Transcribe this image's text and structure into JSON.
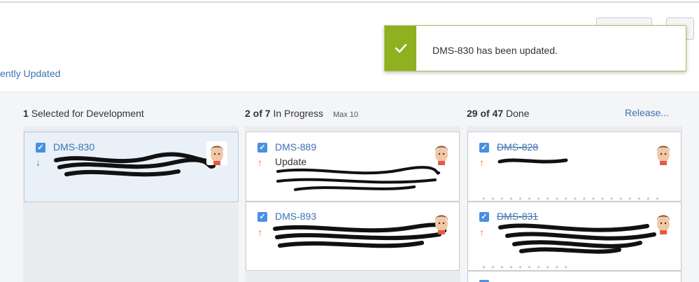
{
  "filter": {
    "recent_label": "ently Updated"
  },
  "toast": {
    "message": "DMS-830 has been updated."
  },
  "columns": [
    {
      "count": "1",
      "title": "Selected for Development",
      "max": ""
    },
    {
      "count": "2 of 7",
      "title": "In Progress",
      "max": "Max 10"
    },
    {
      "count": "29 of 47",
      "title": "Done",
      "max": ""
    }
  ],
  "release_link": "Release...",
  "cards": [
    {
      "key": "DMS-830",
      "summary": "",
      "priority": "down",
      "done": false
    },
    {
      "key": "DMS-889",
      "summary": "Update",
      "priority": "up",
      "done": false
    },
    {
      "key": "DMS-893",
      "summary": "",
      "priority": "up",
      "done": false
    },
    {
      "key": "DMS-828",
      "summary": "",
      "priority": "up",
      "done": true
    },
    {
      "key": "DMS-831",
      "summary": "",
      "priority": "up",
      "done": true
    }
  ],
  "colors": {
    "accent": "#3b73af",
    "success": "#8eb021",
    "priority_up": "#f0752b",
    "priority_down": "#31a354",
    "checkbox": "#4a90e2"
  }
}
